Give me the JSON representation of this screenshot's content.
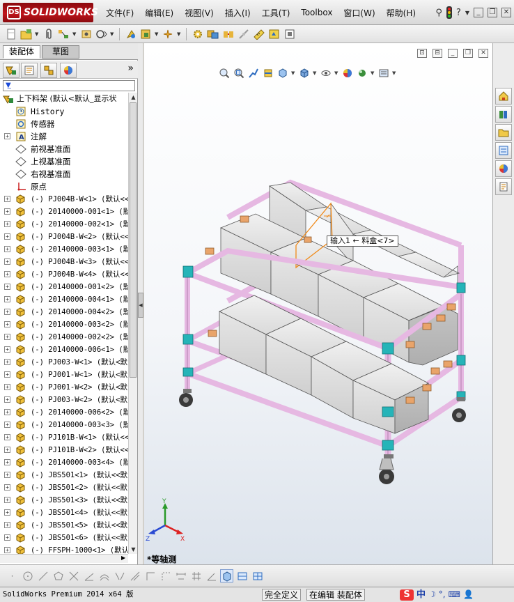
{
  "app": {
    "logo_text": "SOLIDWORKS",
    "brand_color": "#c0141b"
  },
  "menu": [
    {
      "label": "文件(F)"
    },
    {
      "label": "编辑(E)"
    },
    {
      "label": "视图(V)"
    },
    {
      "label": "插入(I)"
    },
    {
      "label": "工具(T)"
    },
    {
      "label": "Toolbox"
    },
    {
      "label": "窗口(W)"
    },
    {
      "label": "帮助(H)"
    }
  ],
  "title_tools": {
    "help_label": "?"
  },
  "left_panel": {
    "tabs": [
      {
        "label": "装配体",
        "active": true
      },
      {
        "label": "草图",
        "active": false
      }
    ],
    "more_label": "»"
  },
  "tree": {
    "root": "上下料架  (默认<默认_显示状",
    "features": [
      {
        "label": "History",
        "icon": "history-icon"
      },
      {
        "label": "传感器",
        "icon": "sensor-icon"
      },
      {
        "label": "注解",
        "icon": "annotation-icon"
      },
      {
        "label": "前视基准面",
        "icon": "plane-icon"
      },
      {
        "label": "上视基准面",
        "icon": "plane-icon"
      },
      {
        "label": "右视基准面",
        "icon": "plane-icon"
      },
      {
        "label": "原点",
        "icon": "origin-icon"
      }
    ],
    "components": [
      {
        "label": "(-) PJ004B-W<1> (默认<<"
      },
      {
        "label": "(-) 20140000-001<1> (默"
      },
      {
        "label": "(-) 20140000-002<1> (默"
      },
      {
        "label": "(-) PJ004B-W<2> (默认<<"
      },
      {
        "label": "(-) 20140000-003<1> (默"
      },
      {
        "label": "(-) PJ004B-W<3> (默认<<"
      },
      {
        "label": "(-) PJ004B-W<4> (默认<<"
      },
      {
        "label": "(-) 20140000-001<2> (默"
      },
      {
        "label": "(-) 20140000-004<1> (默"
      },
      {
        "label": "(-) 20140000-004<2> (默"
      },
      {
        "label": "(-) 20140000-003<2> (默"
      },
      {
        "label": "(-) 20140000-002<2> (默"
      },
      {
        "label": "(-) 20140000-006<1> (默"
      },
      {
        "label": "(-) PJ003-W<1> (默认<默"
      },
      {
        "label": "(-) PJ001-W<1> (默认<默"
      },
      {
        "label": "(-) PJ001-W<2> (默认<默"
      },
      {
        "label": "(-) PJ003-W<2> (默认<默"
      },
      {
        "label": "(-) 20140000-006<2> (默"
      },
      {
        "label": "(-) 20140000-003<3> (默"
      },
      {
        "label": "(-) PJ101B-W<1> (默认<<"
      },
      {
        "label": "(-) PJ101B-W<2> (默认<<"
      },
      {
        "label": "(-) 20140000-003<4> (默"
      },
      {
        "label": "(-) JBS501<1> (默认<<默"
      },
      {
        "label": "(-) JBS501<2> (默认<<默"
      },
      {
        "label": "(-) JBS501<3> (默认<<默"
      },
      {
        "label": "(-) JBS501<4> (默认<<默"
      },
      {
        "label": "(-) JBS501<5> (默认<<默"
      },
      {
        "label": "(-) JBS501<6> (默认<<默"
      },
      {
        "label": "(-) FFSPH-1000<1> (默认"
      }
    ]
  },
  "viewport": {
    "tooltip": "输入1 ← 料盒<7>",
    "view_name": "*等轴测",
    "triad": {
      "x": "X",
      "y": "Y",
      "z": "Z"
    },
    "colors": {
      "frame_pipe": "#e6b8e2",
      "joint": "#25b4b8",
      "bin": "#d7d7d7",
      "connector": "#e9a46a",
      "highlight": "#f08a1a"
    }
  },
  "status": {
    "app": "SolidWorks Premium 2014 x64 版",
    "definition": "完全定义",
    "mode": "在编辑 装配体",
    "ime_logo": "S",
    "ime_text": "中"
  }
}
